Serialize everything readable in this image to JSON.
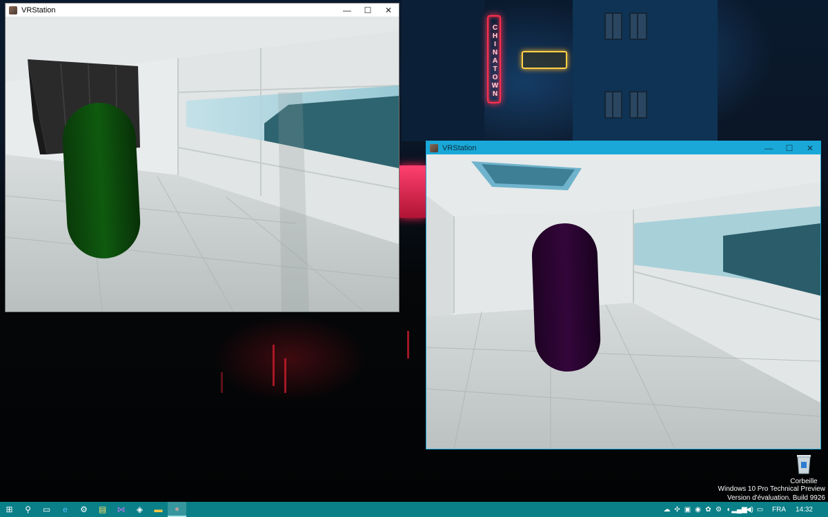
{
  "windows": [
    {
      "title": "VRStation",
      "buttons": {
        "minimize": "—",
        "maximize": "☐",
        "close": "✕"
      }
    },
    {
      "title": "VRStation",
      "buttons": {
        "minimize": "—",
        "maximize": "☐",
        "close": "✕"
      }
    }
  ],
  "wallpaper": {
    "neon_sign": "CHINATOWN"
  },
  "desktop": {
    "recycle_bin_label": "Corbeille"
  },
  "watermark": {
    "line1": "Windows 10 Pro Technical Preview",
    "line2": "Version d'évaluation. Build 9926"
  },
  "taskbar": {
    "items": [
      {
        "name": "start-button",
        "icon": "windows-logo-icon",
        "glyph": "⊞",
        "color": "#ffffff"
      },
      {
        "name": "search-button",
        "icon": "search-icon",
        "glyph": "⚲",
        "color": "#ffffff"
      },
      {
        "name": "task-view-button",
        "icon": "task-view-icon",
        "glyph": "▭",
        "color": "#ffffff"
      },
      {
        "name": "internet-explorer-button",
        "icon": "internet-explorer-icon",
        "glyph": "e",
        "color": "#4fc3f7"
      },
      {
        "name": "steam-button",
        "icon": "steam-icon",
        "glyph": "⚙",
        "color": "#ffffff"
      },
      {
        "name": "notepad-button",
        "icon": "notepad-icon",
        "glyph": "▤",
        "color": "#f4e06a"
      },
      {
        "name": "visual-studio-button",
        "icon": "visual-studio-icon",
        "glyph": "⋈",
        "color": "#b07ae8"
      },
      {
        "name": "unity-button",
        "icon": "unity-icon",
        "glyph": "◈",
        "color": "#ffffff"
      },
      {
        "name": "file-explorer-button",
        "icon": "folder-icon",
        "glyph": "▬",
        "color": "#f5c542"
      },
      {
        "name": "vrstation-button",
        "icon": "vrstation-icon",
        "glyph": "●",
        "color": "#b0a0a0"
      }
    ],
    "tray": {
      "icons": [
        {
          "name": "onedrive-icon",
          "glyph": "☁"
        },
        {
          "name": "tray-app-icon",
          "glyph": "✣"
        },
        {
          "name": "tray-app-2-icon",
          "glyph": "▣"
        },
        {
          "name": "tray-record-icon",
          "glyph": "◉"
        },
        {
          "name": "tray-settings-icon",
          "glyph": "✿"
        },
        {
          "name": "tray-steam-icon",
          "glyph": "⚙"
        },
        {
          "name": "tray-app-3-icon",
          "glyph": "◐"
        },
        {
          "name": "network-icon",
          "glyph": "▂▄▆"
        },
        {
          "name": "volume-icon",
          "glyph": "◀)"
        },
        {
          "name": "action-center-icon",
          "glyph": "▭"
        }
      ],
      "language": "FRA",
      "time": "14:32"
    }
  },
  "colors": {
    "taskbar": "#0a7f88",
    "active_window_border": "#19a8d8",
    "capsule_green": "#0c4a0c",
    "capsule_purple": "#2a0530"
  }
}
